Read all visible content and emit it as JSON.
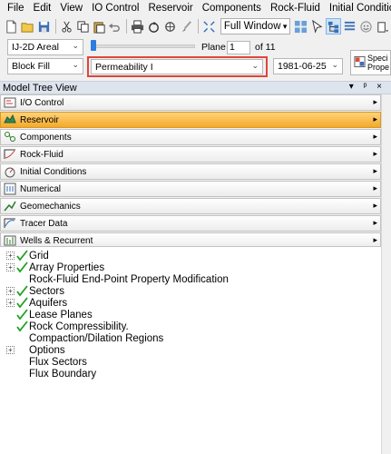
{
  "menu": [
    "File",
    "Edit",
    "View",
    "IO Control",
    "Reservoir",
    "Components",
    "Rock-Fluid",
    "Initial Conditions"
  ],
  "toolbar": {
    "icons": [
      "new-file-icon",
      "open-folder-icon",
      "save-icon",
      "cut-icon",
      "copy-icon",
      "paste-icon",
      "undo-icon",
      "print-icon",
      "refresh-icon",
      "probe-icon",
      "brush-icon",
      "fit-window-icon"
    ],
    "window_mode": "Full Window"
  },
  "controls": {
    "view_mode": "IJ-2D Areal",
    "plane_label": "Plane",
    "plane_value": "1",
    "of_label": "of 11",
    "fill_mode": "Block Fill",
    "property": "Permeability I",
    "date": "1981-06-25",
    "spec_button_line1": "Speci",
    "spec_button_line2": "Prope"
  },
  "panel": {
    "title": "Model Tree View",
    "pins": "▾ ᵖ ×"
  },
  "accordion": [
    {
      "label": "I/O Control",
      "icon": "io-control-icon"
    },
    {
      "label": "Reservoir",
      "icon": "reservoir-icon",
      "selected": true
    },
    {
      "label": "Components",
      "icon": "components-icon"
    },
    {
      "label": "Rock-Fluid",
      "icon": "rock-fluid-icon"
    },
    {
      "label": "Initial Conditions",
      "icon": "initial-conditions-icon"
    },
    {
      "label": "Numerical",
      "icon": "numerical-icon"
    },
    {
      "label": "Geomechanics",
      "icon": "geomechanics-icon"
    },
    {
      "label": "Tracer Data",
      "icon": "tracer-data-icon"
    },
    {
      "label": "Wells & Recurrent",
      "icon": "wells-recurrent-icon"
    }
  ],
  "tree": [
    {
      "label": "Grid",
      "expandable": true,
      "checked": true
    },
    {
      "label": "Array Properties",
      "expandable": true,
      "checked": true
    },
    {
      "label": "Rock-Fluid End-Point Property Modification",
      "expandable": false,
      "checked": false
    },
    {
      "label": "Sectors",
      "expandable": true,
      "checked": true
    },
    {
      "label": "Aquifers",
      "expandable": true,
      "checked": true
    },
    {
      "label": "Lease Planes",
      "expandable": false,
      "checked": true
    },
    {
      "label": "Rock Compressibility.",
      "expandable": false,
      "checked": true
    },
    {
      "label": "Compaction/Dilation Regions",
      "expandable": false,
      "checked": false
    },
    {
      "label": "Options",
      "expandable": true,
      "checked": false
    },
    {
      "label": "Flux Sectors",
      "expandable": false,
      "checked": false
    },
    {
      "label": "Flux Boundary",
      "expandable": false,
      "checked": false
    }
  ],
  "colors": {
    "accent": "#f3a92a",
    "highlight_border": "#e0453a",
    "check_green": "#22a022"
  }
}
